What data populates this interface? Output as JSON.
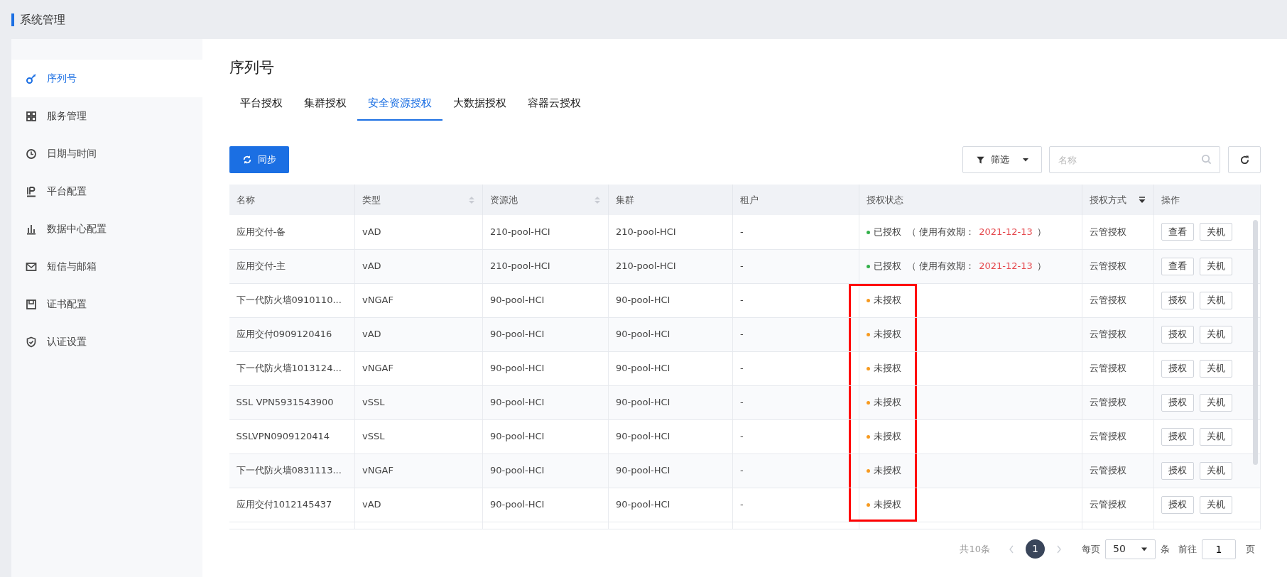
{
  "header": {
    "title": "系统管理"
  },
  "sidebar": {
    "items": [
      {
        "label": "序列号",
        "kind": "key",
        "selected": true
      },
      {
        "label": "服务管理",
        "kind": "grid",
        "selected": false
      },
      {
        "label": "日期与时间",
        "kind": "clock",
        "selected": false
      },
      {
        "label": "平台配置",
        "kind": "ip",
        "selected": false
      },
      {
        "label": "数据中心配置",
        "kind": "bars",
        "selected": false
      },
      {
        "label": "短信与邮箱",
        "kind": "mail",
        "selected": false
      },
      {
        "label": "证书配置",
        "kind": "save",
        "selected": false
      },
      {
        "label": "认证设置",
        "kind": "shield",
        "selected": false
      }
    ]
  },
  "page_title": "序列号",
  "tabs": [
    {
      "label": "平台授权",
      "selected": false
    },
    {
      "label": "集群授权",
      "selected": false
    },
    {
      "label": "安全资源授权",
      "selected": true
    },
    {
      "label": "大数据授权",
      "selected": false
    },
    {
      "label": "容器云授权",
      "selected": false
    }
  ],
  "toolbar": {
    "sync_button": "同步",
    "filter_button": "筛选",
    "search": {
      "placeholder": "名称"
    }
  },
  "table": {
    "columns": [
      {
        "label": "名称",
        "kind": "plain"
      },
      {
        "label": "类型",
        "kind": "sortable"
      },
      {
        "label": "资源池",
        "kind": "sortable"
      },
      {
        "label": "集群",
        "kind": "plain"
      },
      {
        "label": "租户",
        "kind": "plain"
      },
      {
        "label": "授权状态",
        "kind": "plain"
      },
      {
        "label": "授权方式",
        "kind": "sorted"
      },
      {
        "label": "操作",
        "kind": "plain"
      }
    ],
    "rows": [
      {
        "name": "应用交付-备",
        "type": "vAD",
        "pool": "210-pool-HCI",
        "cluster": "210-pool-HCI",
        "tenant": "-",
        "status": {
          "kind": "authorized",
          "label": "已授权",
          "validity_label": "（ 使用有效期：",
          "date": "2021-12-13",
          "close": "）"
        },
        "method": "云管授权",
        "actions": [
          "查看",
          "关机"
        ],
        "highlighted": false
      },
      {
        "name": "应用交付-主",
        "type": "vAD",
        "pool": "210-pool-HCI",
        "cluster": "210-pool-HCI",
        "tenant": "-",
        "status": {
          "kind": "authorized",
          "label": "已授权",
          "validity_label": "（ 使用有效期：",
          "date": "2021-12-13",
          "close": "）"
        },
        "method": "云管授权",
        "actions": [
          "查看",
          "关机"
        ],
        "highlighted": false
      },
      {
        "name": "下一代防火墙0910110...",
        "type": "vNGAF",
        "pool": "90-pool-HCI",
        "cluster": "90-pool-HCI",
        "tenant": "-",
        "status": {
          "kind": "unauthorized",
          "label": "未授权"
        },
        "method": "云管授权",
        "actions": [
          "授权",
          "关机"
        ],
        "highlighted": true
      },
      {
        "name": "应用交付0909120416",
        "type": "vAD",
        "pool": "90-pool-HCI",
        "cluster": "90-pool-HCI",
        "tenant": "-",
        "status": {
          "kind": "unauthorized",
          "label": "未授权"
        },
        "method": "云管授权",
        "actions": [
          "授权",
          "关机"
        ],
        "highlighted": true
      },
      {
        "name": "下一代防火墙1013124...",
        "type": "vNGAF",
        "pool": "90-pool-HCI",
        "cluster": "90-pool-HCI",
        "tenant": "-",
        "status": {
          "kind": "unauthorized",
          "label": "未授权"
        },
        "method": "云管授权",
        "actions": [
          "授权",
          "关机"
        ],
        "highlighted": true
      },
      {
        "name": "SSL VPN5931543900",
        "type": "vSSL",
        "pool": "90-pool-HCI",
        "cluster": "90-pool-HCI",
        "tenant": "-",
        "status": {
          "kind": "unauthorized",
          "label": "未授权"
        },
        "method": "云管授权",
        "actions": [
          "授权",
          "关机"
        ],
        "highlighted": true
      },
      {
        "name": "SSLVPN0909120414",
        "type": "vSSL",
        "pool": "90-pool-HCI",
        "cluster": "90-pool-HCI",
        "tenant": "-",
        "status": {
          "kind": "unauthorized",
          "label": "未授权"
        },
        "method": "云管授权",
        "actions": [
          "授权",
          "关机"
        ],
        "highlighted": true
      },
      {
        "name": "下一代防火墙0831113...",
        "type": "vNGAF",
        "pool": "90-pool-HCI",
        "cluster": "90-pool-HCI",
        "tenant": "-",
        "status": {
          "kind": "unauthorized",
          "label": "未授权"
        },
        "method": "云管授权",
        "actions": [
          "授权",
          "关机"
        ],
        "highlighted": true
      },
      {
        "name": "应用交付1012145437",
        "type": "vAD",
        "pool": "90-pool-HCI",
        "cluster": "90-pool-HCI",
        "tenant": "-",
        "status": {
          "kind": "unauthorized",
          "label": "未授权"
        },
        "method": "云管授权",
        "actions": [
          "授权",
          "关机"
        ],
        "highlighted": true
      }
    ]
  },
  "pagination": {
    "total": "共10条",
    "pages": [
      {
        "label": "1",
        "selected": true
      }
    ],
    "per_page_label": "每页",
    "per_page": "50",
    "per_page_unit": "条",
    "goto_label": "前往",
    "goto_value": "1",
    "goto_unit": "页"
  }
}
